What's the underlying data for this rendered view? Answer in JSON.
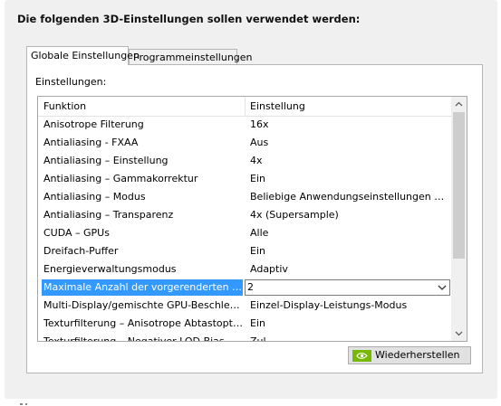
{
  "heading": "Die folgenden 3D-Einstellungen sollen verwendet werden:",
  "tabs": [
    {
      "label": "Globale Einstellungen",
      "active": true
    },
    {
      "label": "Programmeinstellungen",
      "active": false
    }
  ],
  "settings_label": "Einstellungen:",
  "grid": {
    "columns": [
      "Funktion",
      "Einstellung"
    ],
    "rows": [
      {
        "feature": "Anisotrope Filterung",
        "setting": "16x"
      },
      {
        "feature": "Antialiasing - FXAA",
        "setting": "Aus"
      },
      {
        "feature": "Antialiasing – Einstellung",
        "setting": "4x"
      },
      {
        "feature": "Antialiasing – Gammakorrektur",
        "setting": "Ein"
      },
      {
        "feature": "Antialiasing – Modus",
        "setting": "Beliebige Anwendungseinstellungen außer ..."
      },
      {
        "feature": "Antialiasing – Transparenz",
        "setting": "4x (Supersample)"
      },
      {
        "feature": "CUDA – GPUs",
        "setting": "Alle"
      },
      {
        "feature": "Dreifach-Puffer",
        "setting": "Ein"
      },
      {
        "feature": "Energieverwaltungsmodus",
        "setting": "Adaptiv"
      },
      {
        "feature": "Maximale Anzahl der vorgerenderten Einz...",
        "setting": "2",
        "selected": true
      },
      {
        "feature": "Multi-Display/gemischte GPU-Beschleunigung",
        "setting": "Einzel-Display-Leistungs-Modus"
      },
      {
        "feature": "Texturfilterung – Anisotrope Abtastoptimi...",
        "setting": "Ein"
      },
      {
        "feature": "Texturfilterung – Negativer LOD-Bias",
        "setting": "Zul..."
      }
    ]
  },
  "restore_button": "Wiederherstellen",
  "colors": {
    "selection": "#3399ff",
    "panel": "#f0f0f0",
    "nvidia_green": "#76b900"
  },
  "icons": {
    "restore": "nvidia-logo-icon",
    "dropdown": "chevron-down-icon",
    "scroll_up": "scroll-up-arrow-icon",
    "scroll_down": "scroll-down-arrow-icon"
  }
}
